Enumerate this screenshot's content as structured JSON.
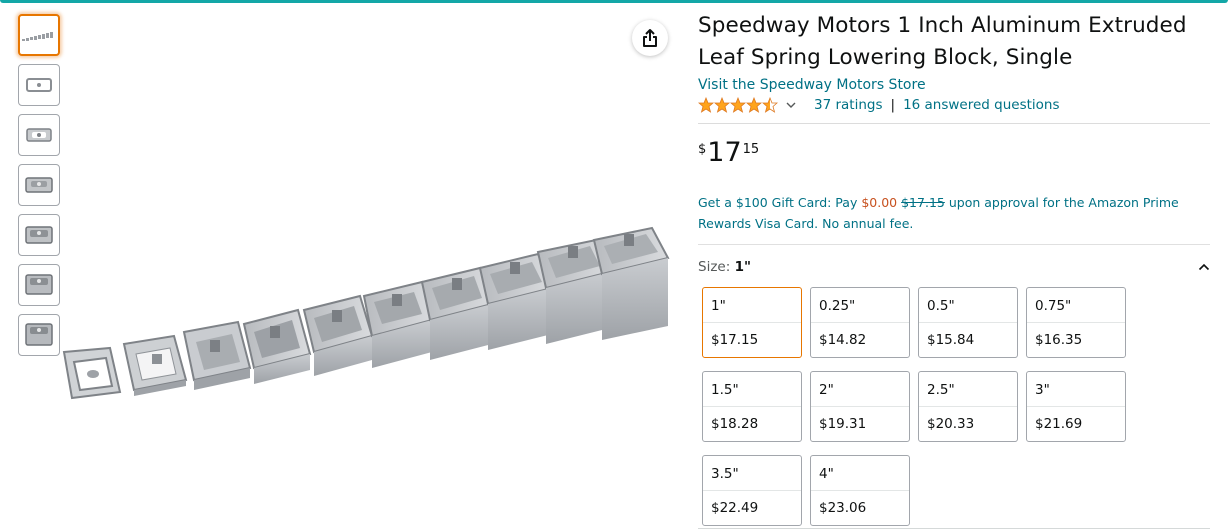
{
  "product": {
    "title": "Speedway Motors 1 Inch Aluminum Extruded Leaf Spring Lowering Block, Single",
    "store_link": "Visit the Speedway Motors Store",
    "rating_value": 4.5,
    "ratings_text": "37 ratings",
    "separator": "|",
    "questions_text": "16 answered questions",
    "price": {
      "symbol": "$",
      "whole": "17",
      "fraction": "15"
    },
    "promo": {
      "part1": "Get a $100 Gift Card: Pay ",
      "zero_price": "$0.00",
      "strike_price": "$17.15",
      "part2": " upon approval for the Amazon Prime Rewards Visa Card. No annual fee."
    },
    "size": {
      "label": "Size: ",
      "selected": "1\"",
      "options": [
        {
          "name": "1\"",
          "price": "$17.15",
          "selected": true
        },
        {
          "name": "0.25\"",
          "price": "$14.82"
        },
        {
          "name": "0.5\"",
          "price": "$15.84"
        },
        {
          "name": "0.75\"",
          "price": "$16.35"
        },
        {
          "name": "1.5\"",
          "price": "$18.28"
        },
        {
          "name": "2\"",
          "price": "$19.31"
        },
        {
          "name": "2.5\"",
          "price": "$20.33"
        },
        {
          "name": "3\"",
          "price": "$21.69"
        },
        {
          "name": "3.5\"",
          "price": "$22.49"
        },
        {
          "name": "4\"",
          "price": "$23.06"
        }
      ]
    }
  },
  "colors": {
    "link": "#007185",
    "star": "#ffa41c",
    "selected_border": "#e77600",
    "promo_price": "#c7511f"
  },
  "icons": {
    "share": "share-icon",
    "chevron": "chevron-down-icon",
    "collapse": "chevron-up-icon"
  }
}
